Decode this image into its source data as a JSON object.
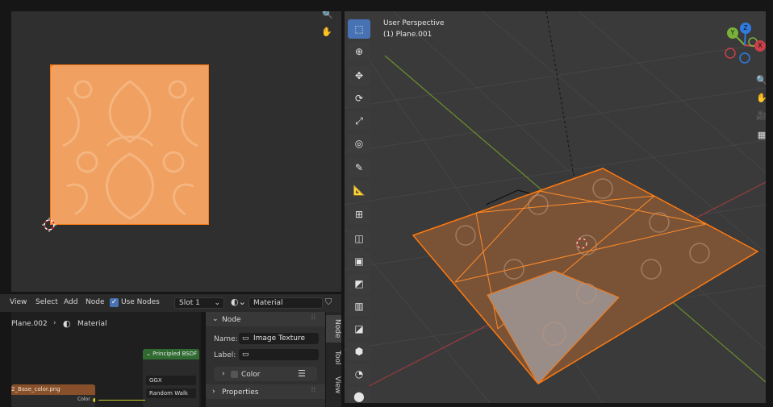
{
  "uv_editor": {
    "zoom_icon": "magnifier-plus-icon",
    "pan_icon": "hand-icon"
  },
  "node_editor": {
    "menu": {
      "view": "View",
      "select": "Select",
      "add": "Add",
      "node": "Node"
    },
    "use_nodes_label": "Use Nodes",
    "slot": "Slot 1",
    "material_name": "Material",
    "breadcrumb": {
      "object": "Plane.002",
      "material": "Material"
    },
    "nodes": {
      "principled_title": "Principled BSDF",
      "distribution": "GGX",
      "subsurface": "Random Walk",
      "image_node_title": "2_Base_color.png",
      "color_socket": "Color"
    }
  },
  "sidebar": {
    "node_panel_title": "Node",
    "name_label": "Name:",
    "name_value": "Image Texture",
    "label_label": "Label:",
    "label_value": "",
    "color_section": "Color",
    "properties_section": "Properties",
    "tabs": [
      "Node",
      "Tool",
      "View"
    ]
  },
  "viewport": {
    "perspective": "User Perspective",
    "object": "(1) Plane.001",
    "gizmo": {
      "x": "X",
      "y": "Y",
      "z": "Z"
    },
    "colors": {
      "x_axis": "#c9404a",
      "y_axis": "#7ab13a",
      "z_axis": "#2f7be0",
      "selection": "#ff7a10",
      "active_tool": "#4772b3"
    }
  }
}
